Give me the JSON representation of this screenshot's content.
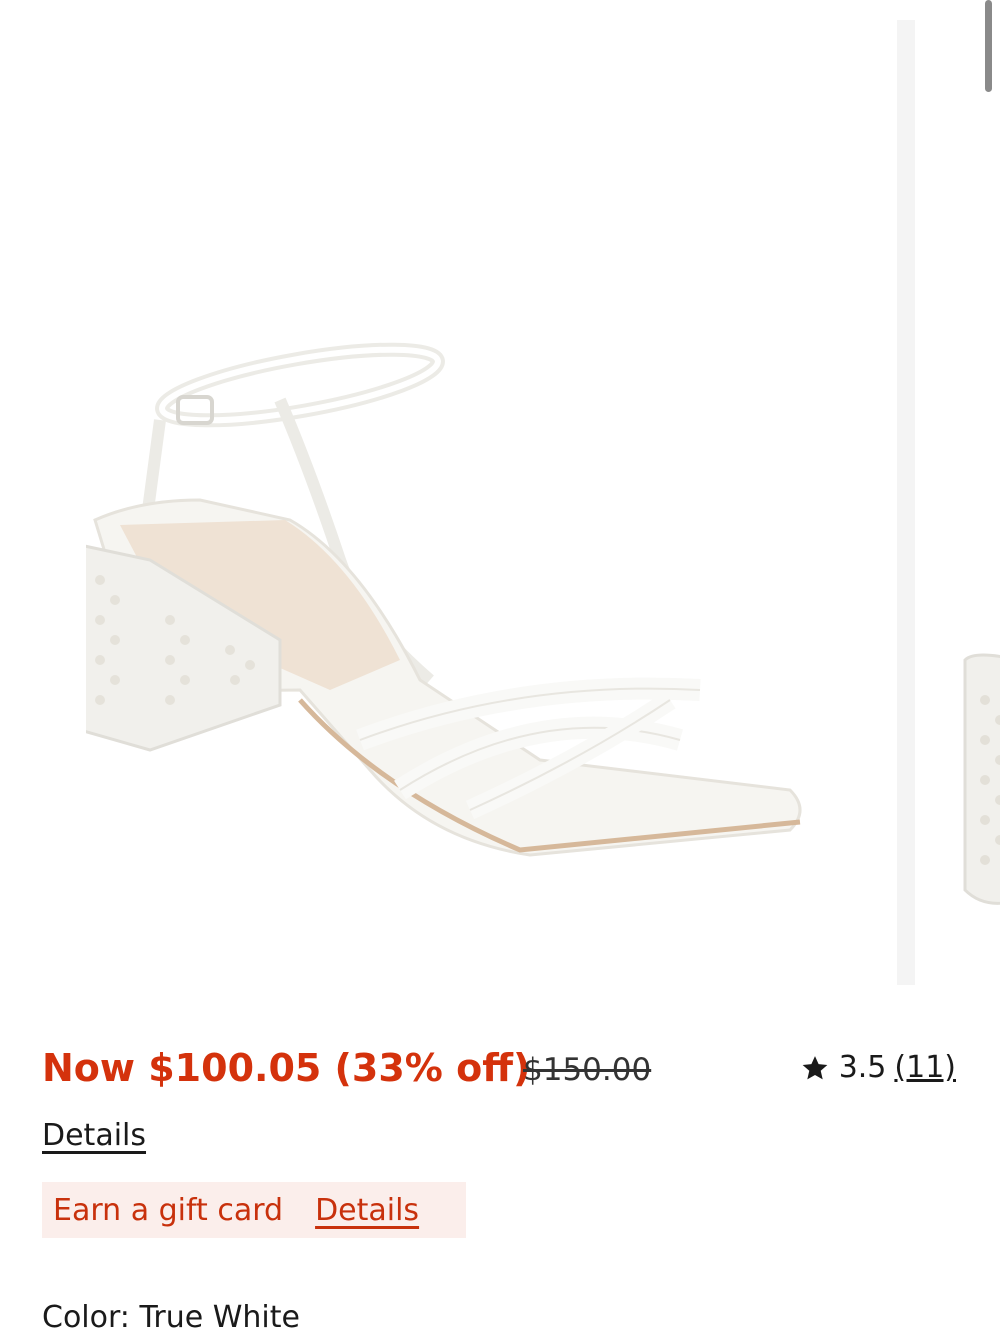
{
  "product": {
    "price_now_label": "Now $100.05 (33% off)",
    "price_original": "$150.00",
    "rating_value": "3.5",
    "rating_count": "(11)",
    "details_link": "Details",
    "gift_card_label": "Earn a gift card",
    "gift_card_details": "Details",
    "color_label": "Color: True White"
  },
  "colors": {
    "sale_red": "#d4320c",
    "gift_bg": "#fbeeeb",
    "text_dark": "#1a1a1a"
  },
  "icons": {
    "rating": "star-icon"
  }
}
